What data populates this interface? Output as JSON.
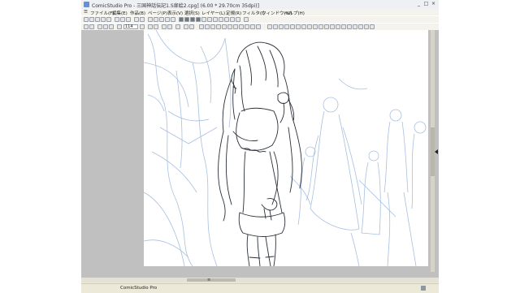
{
  "window": {
    "title": "ComicStudio Pro - 三国神話伝記1.S扉絵2.cpg] (6.00 * 29.70cm 35dpi)]",
    "controls": [
      "_",
      "□",
      "×"
    ]
  },
  "menubar": {
    "items": [
      "ファイル(F)",
      "編集(E)",
      "作品(B)",
      "ページ(P)",
      "表示(V)",
      "選択(S)",
      "レイヤー(L)",
      "定規(R)",
      "フィルタ(I)",
      "ウィンドウ(W)",
      "ヘルプ(H)"
    ]
  },
  "toolbar": {
    "zoom_value": "114"
  },
  "statusbar": {
    "text": "ComicStudio Pro"
  },
  "hscroll": {
    "thumb_label": "≡"
  },
  "colors": {
    "sketch_blue": "#9fb9dd",
    "line_ink": "#2a2f38",
    "workarea_gray": "#c0c0c0"
  }
}
